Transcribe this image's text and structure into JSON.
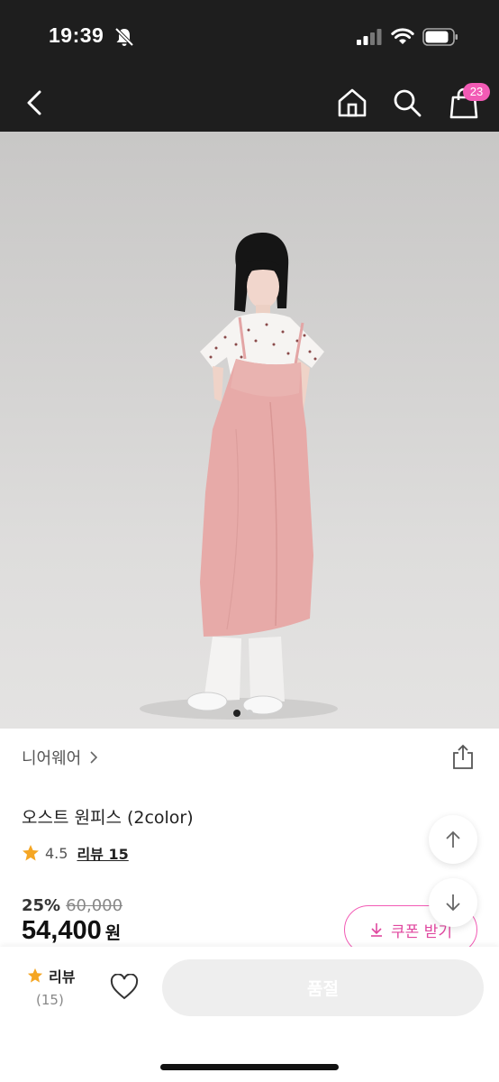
{
  "status_bar": {
    "time": "19:39"
  },
  "nav": {
    "cart_count": "23"
  },
  "gallery": {
    "current_index": 1,
    "total": 2
  },
  "product": {
    "brand": "니어웨어",
    "name": "오스트 원피스 (2color)",
    "rating": "4.5",
    "review_label": "리뷰 15",
    "discount_rate": "25%",
    "original_price": "60,000",
    "price": "54,400",
    "price_unit": "원"
  },
  "coupon": {
    "label": "쿠폰 받기"
  },
  "bottom_bar": {
    "review_label": "리뷰",
    "review_count": "(15)",
    "soldout_label": "품절"
  },
  "colors": {
    "accent": "#f25bb5",
    "star": "#f5a623",
    "header": "#1e1e1e"
  }
}
